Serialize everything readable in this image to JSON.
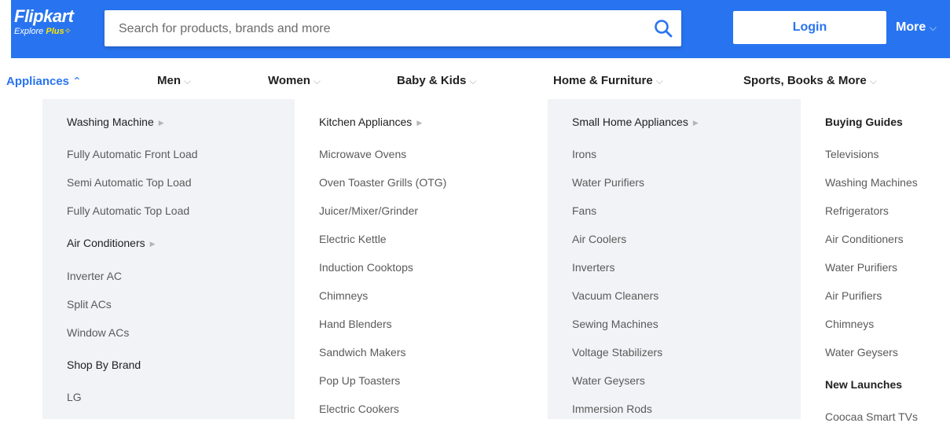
{
  "header": {
    "logo_main": "Flipkart",
    "logo_sub": "Explore",
    "logo_plus": "Plus",
    "search_placeholder": "Search for products, brands and more",
    "login_label": "Login",
    "more_label": "More",
    "colors": {
      "brand": "#2874f0",
      "plus": "#ffe500"
    }
  },
  "nav": {
    "items": [
      {
        "label": "Appliances",
        "active": true
      },
      {
        "label": "Men"
      },
      {
        "label": "Women"
      },
      {
        "label": "Baby & Kids"
      },
      {
        "label": "Home & Furniture"
      },
      {
        "label": "Sports, Books & More"
      }
    ]
  },
  "menu": {
    "columns": [
      {
        "sections": [
          {
            "heading": "Washing Machine",
            "items": [
              "Fully Automatic Front Load",
              "Semi Automatic Top Load",
              "Fully Automatic Top Load"
            ]
          },
          {
            "heading": "Air Conditioners",
            "items": [
              "Inverter AC",
              "Split ACs",
              "Window ACs"
            ]
          },
          {
            "heading": "Shop By Brand",
            "items": [
              "LG"
            ]
          }
        ]
      },
      {
        "sections": [
          {
            "heading": "Kitchen Appliances",
            "items": [
              "Microwave Ovens",
              "Oven Toaster Grills (OTG)",
              "Juicer/Mixer/Grinder",
              "Electric Kettle",
              "Induction Cooktops",
              "Chimneys",
              "Hand Blenders",
              "Sandwich Makers",
              "Pop Up Toasters",
              "Electric Cookers"
            ]
          }
        ]
      },
      {
        "sections": [
          {
            "heading": "Small Home Appliances",
            "items": [
              "Irons",
              "Water Purifiers",
              "Fans",
              "Air Coolers",
              "Inverters",
              "Vacuum Cleaners",
              "Sewing Machines",
              "Voltage Stabilizers",
              "Water Geysers",
              "Immersion Rods"
            ]
          }
        ]
      },
      {
        "sections": [
          {
            "heading": "Buying Guides",
            "items": [
              "Televisions",
              "Washing Machines",
              "Refrigerators",
              "Air Conditioners",
              "Water Purifiers",
              "Air Purifiers",
              "Chimneys",
              "Water Geysers"
            ]
          },
          {
            "heading": "New Launches",
            "items": [
              "Coocaa Smart TVs"
            ]
          }
        ]
      }
    ]
  }
}
